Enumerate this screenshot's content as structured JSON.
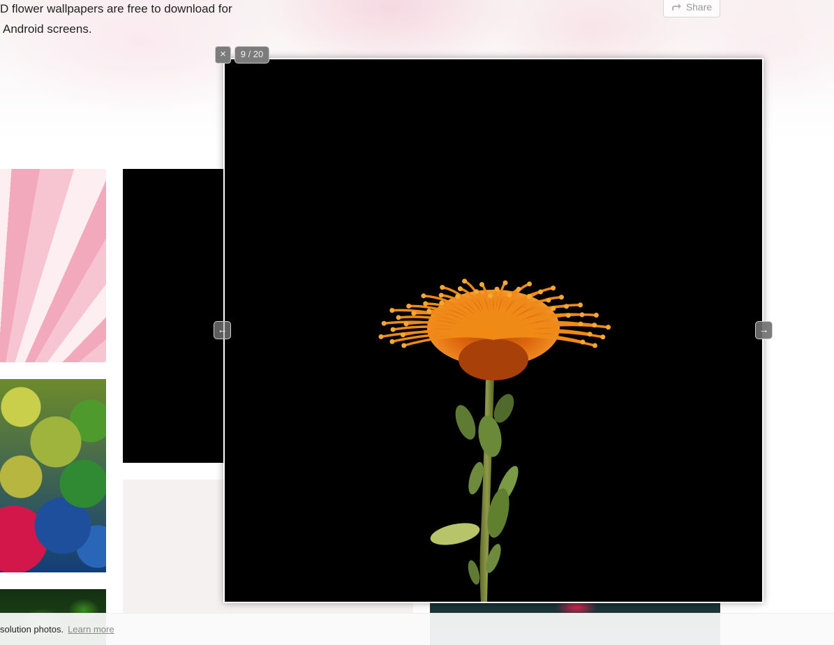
{
  "page": {
    "intro_line_1": "D flower wallpapers are free to download for",
    "intro_line_2": "Android screens.",
    "share_label": "Share"
  },
  "gallery": {
    "thumbnails": [
      {
        "subject": "pink-white-dahlia"
      },
      {
        "subject": "dark-background"
      },
      {
        "subject": "mixed-color-flower-carpet"
      },
      {
        "subject": "pale-pink"
      },
      {
        "subject": "green-leaves"
      },
      {
        "subject": "teal-with-red-flower"
      }
    ]
  },
  "cookie_notice": {
    "text": "solution photos.",
    "link_label": "Learn more"
  },
  "lightbox": {
    "close_label": "×",
    "counter": "9 / 20",
    "prev_label": "←",
    "next_label": "→",
    "image_subject": "orange pincushion protea on black background",
    "colors": {
      "background": "#000000",
      "bloom": "#f07a12",
      "stem": "#7e8a3e",
      "leaf": "#5e7a33"
    }
  }
}
